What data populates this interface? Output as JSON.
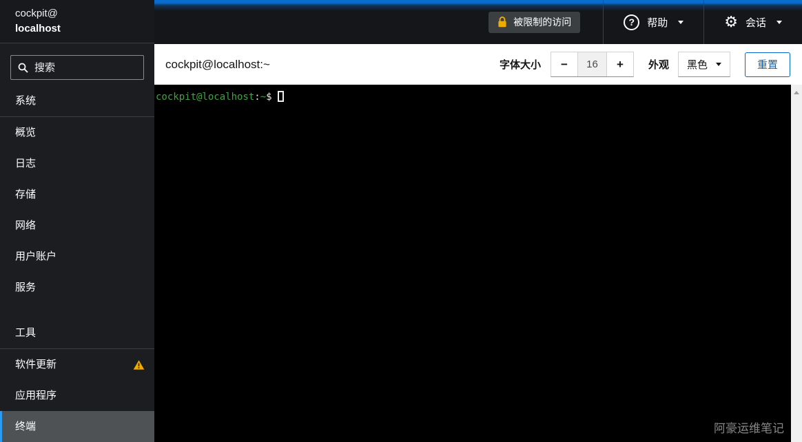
{
  "colors": {
    "accent_blue": "#0066cc",
    "selected_indicator_blue": "#2b9af3",
    "warning_gold": "#f0ab00",
    "sidebar_bg": "#1b1d21",
    "masthead_bg": "#141619",
    "terminal_bg": "#000000",
    "prompt_green": "#42a142"
  },
  "icons": {
    "search-icon": "magnifier",
    "lock-icon": "gold padlock",
    "help-icon": "question mark in circle",
    "gear-icon": "⚙ gear",
    "chevron-down-icon": "▾ caret down",
    "warning-icon": "⚠ gold triangle with exclamation",
    "minus-icon": "−",
    "plus-icon": "+",
    "scroll-up-icon": "▲"
  },
  "brand": {
    "line1": "cockpit@",
    "line2": "localhost"
  },
  "sidebar": {
    "search_placeholder": "搜索",
    "groups": [
      {
        "title": "系统",
        "items": [
          {
            "label": "概览"
          },
          {
            "label": "日志"
          },
          {
            "label": "存储"
          },
          {
            "label": "网络"
          },
          {
            "label": "用户账户"
          },
          {
            "label": "服务"
          }
        ]
      },
      {
        "title": "工具",
        "items": [
          {
            "label": "软件更新",
            "warning": true
          },
          {
            "label": "应用程序"
          },
          {
            "label": "终端",
            "selected": true
          }
        ]
      }
    ]
  },
  "masthead": {
    "restricted_label": "被限制的访问",
    "help_label": "帮助",
    "session_label": "会话"
  },
  "toolbar": {
    "title": "cockpit@localhost:~",
    "font_size_label": "字体大小",
    "decrease_label": "−",
    "font_size_value": "16",
    "increase_label": "+",
    "appearance_label": "外观",
    "theme_value": "黑色",
    "reset_label": "重置"
  },
  "terminal": {
    "prompt_user_host": "cockpit@localhost",
    "prompt_colon": ":",
    "prompt_path": "~",
    "prompt_dollar": "$",
    "watermark": "阿豪运维笔记"
  }
}
